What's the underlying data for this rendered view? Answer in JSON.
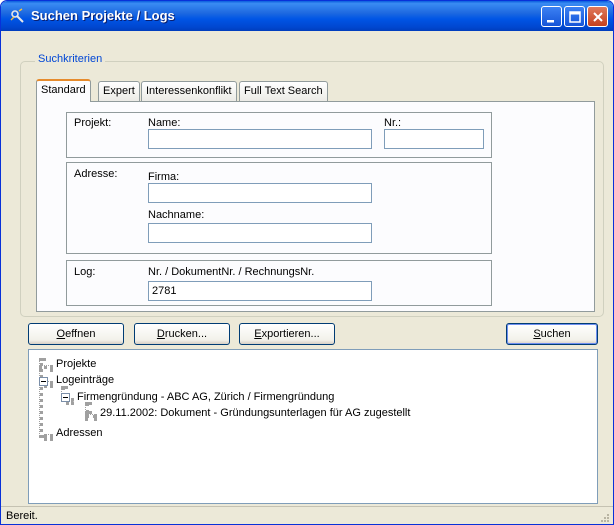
{
  "window": {
    "title": "Suchen Projekte / Logs"
  },
  "search_group": {
    "legend": "Suchkriterien",
    "tabs": [
      {
        "label": "Standard",
        "active": true
      },
      {
        "label": "Expert",
        "active": false
      },
      {
        "label": "Interessenkonflikt",
        "active": false
      },
      {
        "label": "Full Text Search",
        "active": false
      }
    ],
    "projekt": {
      "section_label": "Projekt:",
      "name_label": "Name:",
      "name_value": "",
      "nr_label": "Nr.:",
      "nr_value": ""
    },
    "adresse": {
      "section_label": "Adresse:",
      "firma_label": "Firma:",
      "firma_value": "",
      "nachname_label": "Nachname:",
      "nachname_value": ""
    },
    "log": {
      "section_label": "Log:",
      "nr_label": "Nr. / DokumentNr. / RechnungsNr.",
      "nr_value": "2781"
    }
  },
  "buttons": {
    "oeffnen": {
      "accel": "O",
      "rest": "effnen"
    },
    "drucken": {
      "accel": "D",
      "rest": "rucken..."
    },
    "exportieren": {
      "accel": "E",
      "rest": "xportieren..."
    },
    "suchen": {
      "accel": "S",
      "rest": "uchen"
    }
  },
  "tree": {
    "projekte": "Projekte",
    "logeintraege": "Logeinträge",
    "firmengruendung": "Firmengründung - ABC AG, Zürich / Firmengründung",
    "dokument": "29.11.2002: Dokument - Gründungsunterlagen für AG zugestellt",
    "adressen": "Adressen"
  },
  "status": {
    "text": "Bereit."
  },
  "colors": {
    "titlebar": "#0055e5",
    "window_bg": "#ece9d8",
    "legend": "#0046d5",
    "tab_highlight": "#e68b2c"
  }
}
